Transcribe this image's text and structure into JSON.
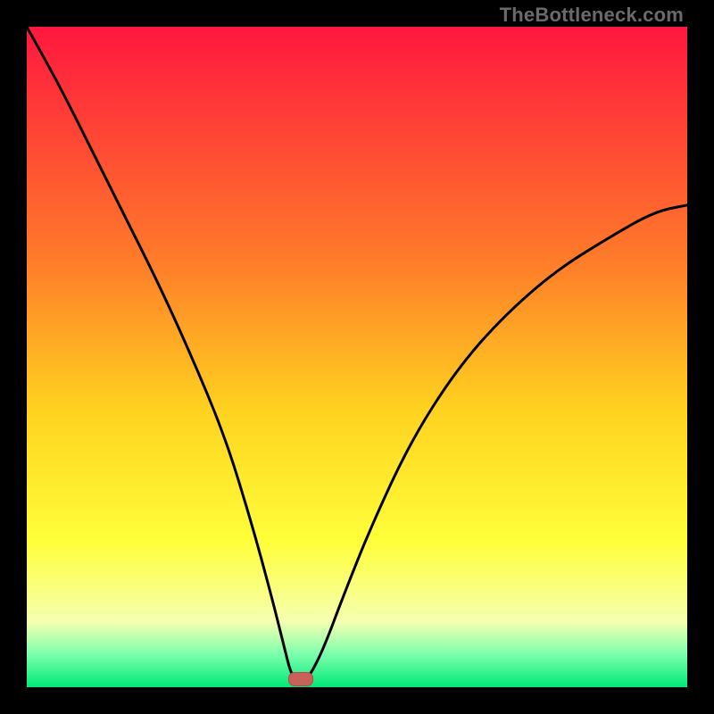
{
  "watermark": "TheBottleneck.com",
  "colors": {
    "frame_bg": "#000000",
    "grad_top": "#ff173f",
    "grad_mid_upper": "#ff7a2a",
    "grad_mid": "#ffd21f",
    "grad_yellow": "#ffff3a",
    "grad_pale": "#f6ffb0",
    "grad_mint": "#7dffad",
    "grad_green": "#00e877",
    "curve": "#000000",
    "marker_fill": "#c9605a",
    "marker_border": "#b14c48"
  },
  "chart_data": {
    "type": "line",
    "title": "",
    "xlabel": "",
    "ylabel": "",
    "xlim": [
      0,
      100
    ],
    "ylim": [
      0,
      100
    ],
    "series": [
      {
        "name": "bottleneck-curve",
        "x": [
          0,
          5,
          10,
          15,
          20,
          25,
          30,
          34,
          37,
          39,
          40,
          41,
          42,
          43,
          45,
          48,
          52,
          58,
          65,
          72,
          80,
          88,
          95,
          100
        ],
        "values": [
          100,
          91,
          81,
          71,
          61,
          50,
          38,
          25,
          14,
          6,
          2,
          1,
          1,
          2,
          6,
          14,
          24,
          37,
          48,
          56,
          63,
          68,
          72,
          73
        ]
      }
    ],
    "marker": {
      "x": 41.5,
      "y": 1.2
    },
    "gradient_stops": [
      {
        "pct": 0,
        "color": "#ff173f"
      },
      {
        "pct": 35,
        "color": "#ff7a2a"
      },
      {
        "pct": 58,
        "color": "#ffd21f"
      },
      {
        "pct": 78,
        "color": "#ffff3a"
      },
      {
        "pct": 90,
        "color": "#f6ffb0"
      },
      {
        "pct": 95,
        "color": "#7dffad"
      },
      {
        "pct": 100,
        "color": "#00e877"
      }
    ]
  }
}
